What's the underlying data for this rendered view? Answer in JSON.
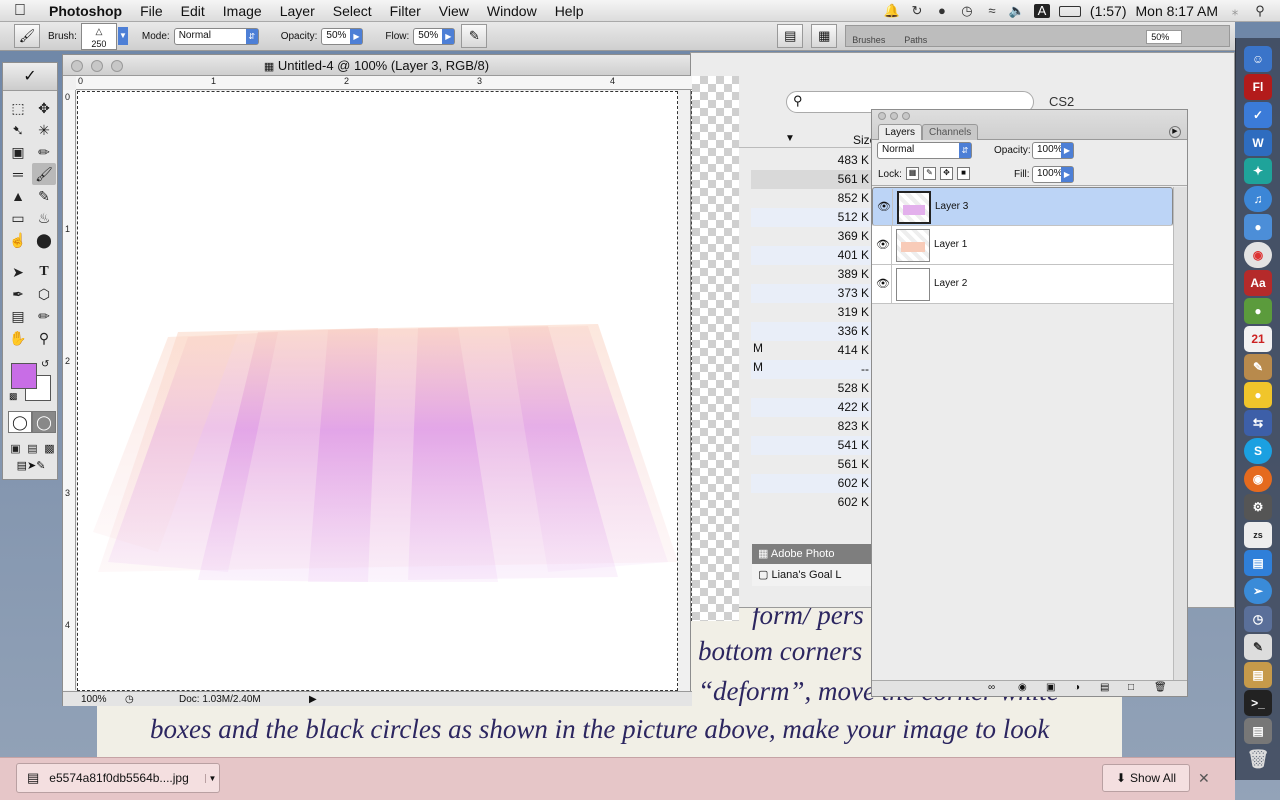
{
  "menubar": {
    "apple": "",
    "items": [
      "Photoshop",
      "File",
      "Edit",
      "Image",
      "Layer",
      "Select",
      "Filter",
      "View",
      "Window",
      "Help"
    ],
    "battery": "(1:57)",
    "clock": "Mon 8:17 AM"
  },
  "options": {
    "brush_label": "Brush:",
    "brush_size": "250",
    "mode_label": "Mode:",
    "mode_value": "Normal",
    "opacity_label": "Opacity:",
    "opacity_value": "50%",
    "flow_label": "Flow:",
    "flow_value": "50%",
    "tab_brushes": "Brushes",
    "tab_paths": "Paths",
    "zoom_field": "50%"
  },
  "document": {
    "title": "Untitled-4 @ 100% (Layer 3, RGB/8)",
    "zoom": "100%",
    "doc_info": "Doc: 1.03M/2.40M",
    "ruler_top": [
      "0",
      "1",
      "2",
      "3",
      "4"
    ],
    "ruler_left": [
      "0",
      "1",
      "2",
      "3",
      "4"
    ]
  },
  "filewin": {
    "label_cs2": "CS2",
    "size_header": "Size",
    "sizes": [
      "483 K",
      "561 K",
      "852 K",
      "512 K",
      "369 K",
      "401 K",
      "389 K",
      "373 K",
      "319 K",
      "336 K",
      "414 K",
      "--",
      "528 K",
      "422 K",
      "823 K",
      "541 K",
      "561 K",
      "602 K",
      "602 K"
    ],
    "left_fragments": [
      "M",
      "M"
    ],
    "adobe_label": "Adobe Photo",
    "goal_label": "Liana's Goal L"
  },
  "layers": {
    "tab_layers": "Layers",
    "tab_channels": "Channels",
    "blend_mode": "Normal",
    "opacity_label": "Opacity:",
    "opacity_value": "100%",
    "lock_label": "Lock:",
    "fill_label": "Fill:",
    "fill_value": "100%",
    "rows": [
      {
        "name": "Layer 3",
        "selected": true
      },
      {
        "name": "Layer 1",
        "selected": false
      },
      {
        "name": "Layer 2",
        "selected": false
      }
    ]
  },
  "bgpage": {
    "lines": [
      "form/ pers",
      "bottom corners",
      "“deform”, move the corner white",
      "boxes and the black circles as shown in the picture above, make your image to look"
    ]
  },
  "downloads": {
    "filename": "e5574a81f0db5564b....jpg",
    "show_all": "Show All"
  },
  "colors": {
    "foreground": "#c86de6",
    "selection": "#bcd4f6",
    "accent": "#4d7fd6"
  }
}
